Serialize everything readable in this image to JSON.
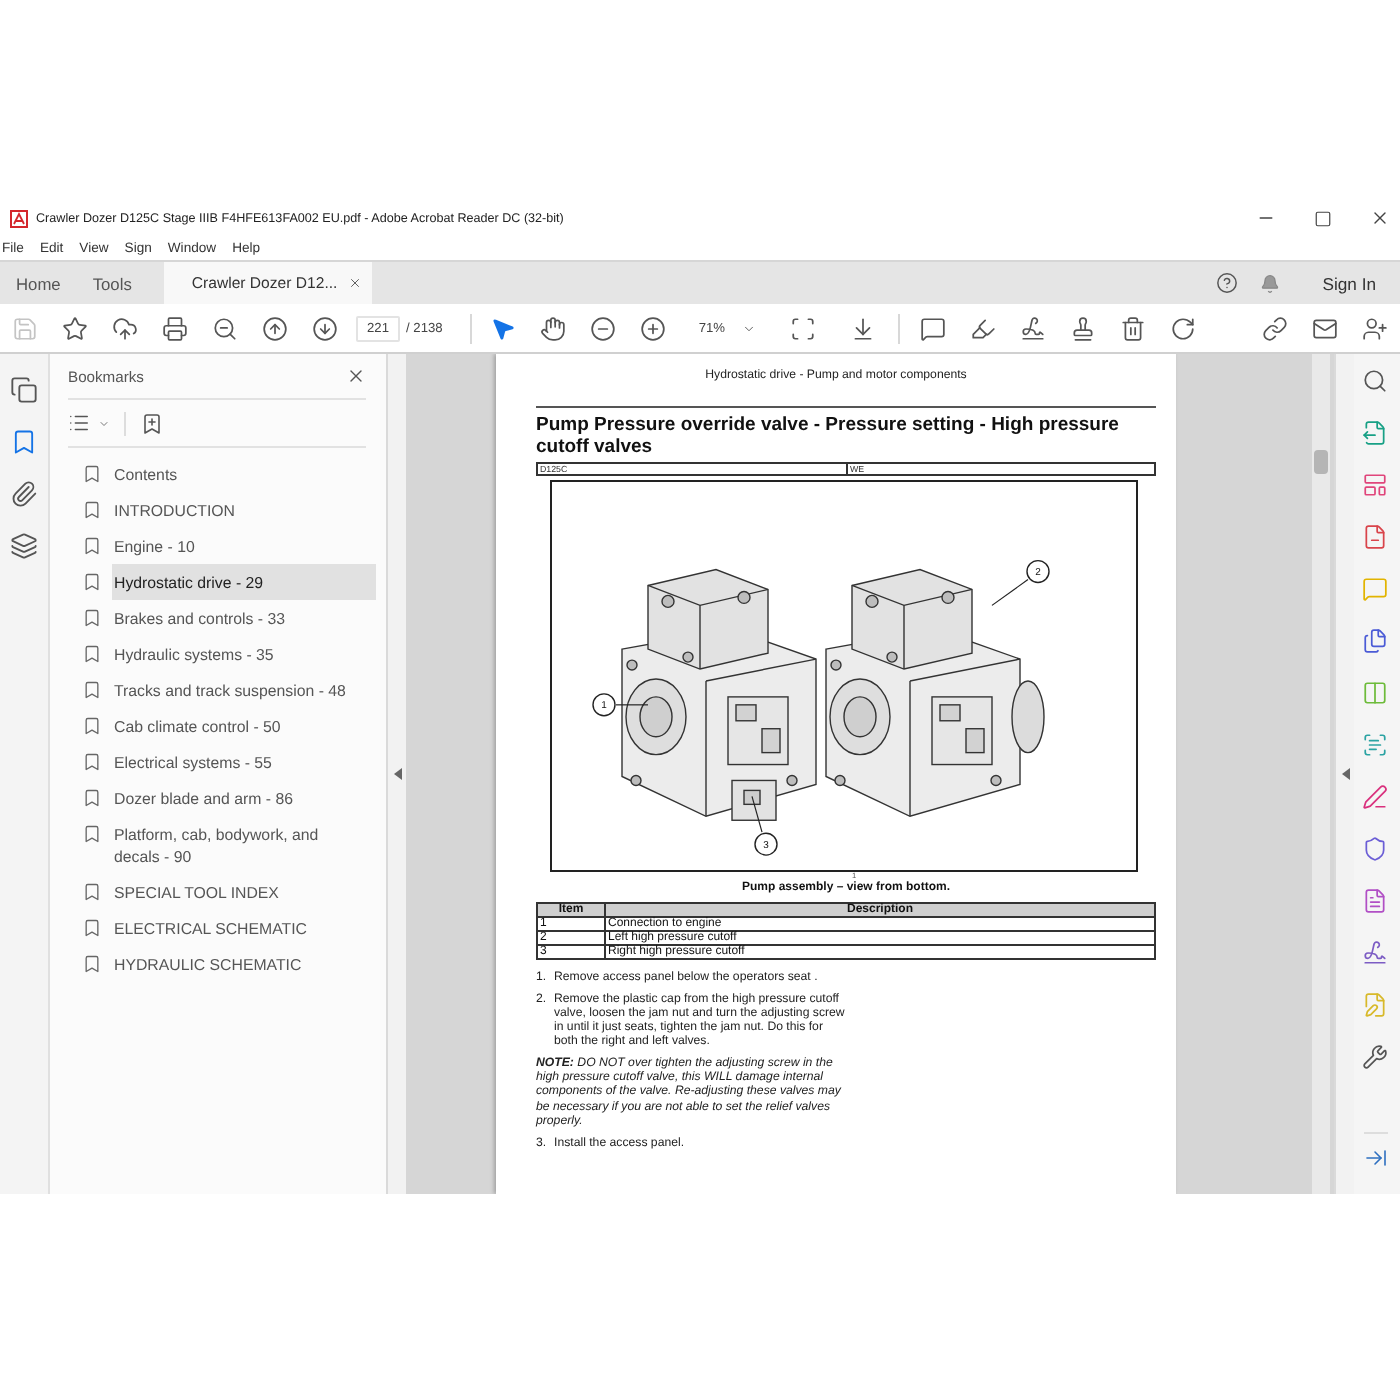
{
  "window": {
    "title": "Crawler Dozer D125C Stage IIIB F4HFE613FA002 EU.pdf - Adobe Acrobat Reader DC (32-bit)"
  },
  "menu": [
    "File",
    "Edit",
    "View",
    "Sign",
    "Window",
    "Help"
  ],
  "tabs": [
    {
      "label": "Home",
      "kind": "nav",
      "selected": false
    },
    {
      "label": "Tools",
      "kind": "nav",
      "selected": false
    },
    {
      "label": "Crawler Dozer D12...",
      "kind": "document",
      "selected": true
    }
  ],
  "account": {
    "sign_in": "Sign In"
  },
  "toolbar": {
    "save_disabled": true,
    "page_number": "221",
    "page_total": "/ 2138",
    "zoom": "71%",
    "tools": [
      {
        "kind": "select",
        "selected": true
      },
      {
        "kind": "hand",
        "selected": false
      }
    ]
  },
  "nav_rail": [
    {
      "kind": "pages",
      "selected": false
    },
    {
      "kind": "bookmarks",
      "selected": true
    },
    {
      "kind": "attachments",
      "selected": false
    },
    {
      "kind": "layers",
      "selected": false
    }
  ],
  "bookmarks": {
    "title": "Bookmarks",
    "items": [
      {
        "label": "Contents",
        "selected": false
      },
      {
        "label": "INTRODUCTION",
        "selected": false
      },
      {
        "label": "Engine - 10",
        "selected": false
      },
      {
        "label": "Hydrostatic drive - 29",
        "selected": true
      },
      {
        "label": "Brakes and controls - 33",
        "selected": false
      },
      {
        "label": "Hydraulic systems - 35",
        "selected": false
      },
      {
        "label": "Tracks and track suspension - 48",
        "selected": false
      },
      {
        "label": "Cab climate control - 50",
        "selected": false
      },
      {
        "label": "Electrical systems - 55",
        "selected": false
      },
      {
        "label": "Dozer blade and arm - 86",
        "selected": false
      },
      {
        "label": "Platform, cab, bodywork, and decals - 90",
        "selected": false
      },
      {
        "label": "SPECIAL TOOL INDEX",
        "selected": false
      },
      {
        "label": "ELECTRICAL SCHEMATIC",
        "selected": false
      },
      {
        "label": "HYDRAULIC SCHEMATIC",
        "selected": false
      }
    ]
  },
  "document": {
    "running_header": "Hydrostatic drive - Pump and motor components",
    "title": "Pump Pressure override valve - Pressure setting - High pressure cutoff valves",
    "info_bar": [
      "D125C",
      "WE"
    ],
    "figure": {
      "callouts": [
        "1",
        "2",
        "3"
      ],
      "number": "1",
      "caption": "Pump assembly – view from bottom."
    },
    "table": {
      "columns": [
        "Item",
        "Description"
      ],
      "rows": [
        [
          "1",
          "Connection to engine"
        ],
        [
          "2",
          "Left high pressure cutoff"
        ],
        [
          "3",
          "Right high pressure cutoff"
        ]
      ]
    },
    "steps": [
      {
        "kind": "step",
        "number": "1.",
        "text": "Remove access panel below the operators seat ."
      },
      {
        "kind": "step",
        "number": "2.",
        "text": "Remove the plastic cap from the high pressure cutoff valve, loosen the jam nut and turn the adjusting screw in until it just seats, tighten the jam nut. Do this for both the right and left valves."
      },
      {
        "kind": "note",
        "text": "**NOTE:** DO NOT over tighten the adjusting screw in the high pressure cutoff valve, this WILL damage internal components of the valve. Re-adjusting these valves may be necessary if you are not able to set the relief valves properly."
      },
      {
        "kind": "step",
        "number": "3.",
        "text": "Install the access panel."
      }
    ]
  }
}
